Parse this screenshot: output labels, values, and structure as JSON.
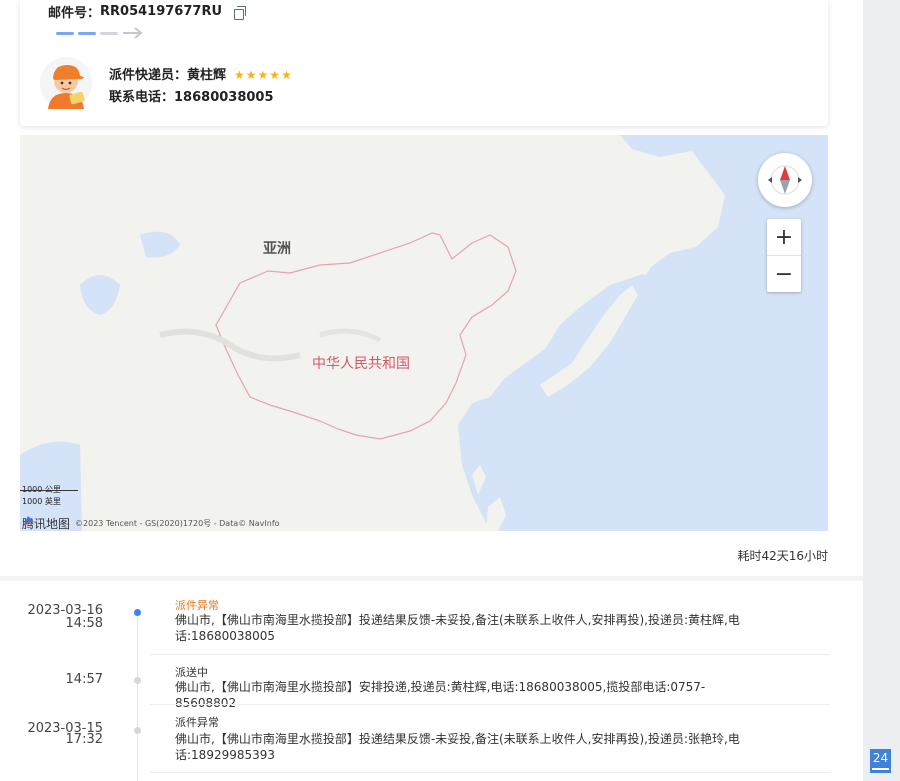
{
  "parcel": {
    "mail_label": "邮件号：",
    "mail_number": "RR054197677RU"
  },
  "courier": {
    "name_label": "派件快递员：",
    "name": "黄柱辉",
    "rating": 5,
    "stars": "★★★★★",
    "phone_label": "联系电话：",
    "phone": "18680038005"
  },
  "progress": {
    "completed_steps": 2,
    "total_steps": 4
  },
  "map": {
    "labels": {
      "continent": "亚洲",
      "country": "中华人民共和国"
    },
    "scale": {
      "metric": "1000 公里",
      "imperial": "1000 英里"
    },
    "attribution": {
      "logo_text": "腾讯地图",
      "copyright": "©2023 Tencent - GS(2020)1720号 - Data© NavInfo"
    },
    "zoom": {
      "in": "+",
      "out": "−"
    }
  },
  "elapsed": "耗时42天16小时",
  "timeline": [
    {
      "date": "2023-03-16",
      "time": "14:58",
      "status": "派件异常",
      "description": "佛山市,【佛山市南海里水揽投部】投递结果反馈-未妥投,备注(未联系上收件人,安排再投),投递员:黄柱辉,电话:18680038005",
      "active": true
    },
    {
      "date": "",
      "time": "14:57",
      "status": "派送中",
      "description": "佛山市,【佛山市南海里水揽投部】安排投递,投递员:黄柱辉,电话:18680038005,揽投部电话:0757-85608802",
      "active": false
    },
    {
      "date": "2023-03-15",
      "time": "17:32",
      "status": "派件异常",
      "description": "佛山市,【佛山市南海里水揽投部】投递结果反馈-未妥投,备注(未联系上收件人,安排再投),投递员:张艳玲,电话:18929985393",
      "active": false
    }
  ],
  "page_badge": "24",
  "colors": {
    "accent": "#3e83f2",
    "warning": "#e8771b",
    "star": "#f5b31a",
    "progress_on": "#7aa7ef",
    "progress_off": "#d3d6dc",
    "water": "#d4e3f7",
    "land": "#f2f2ee"
  }
}
